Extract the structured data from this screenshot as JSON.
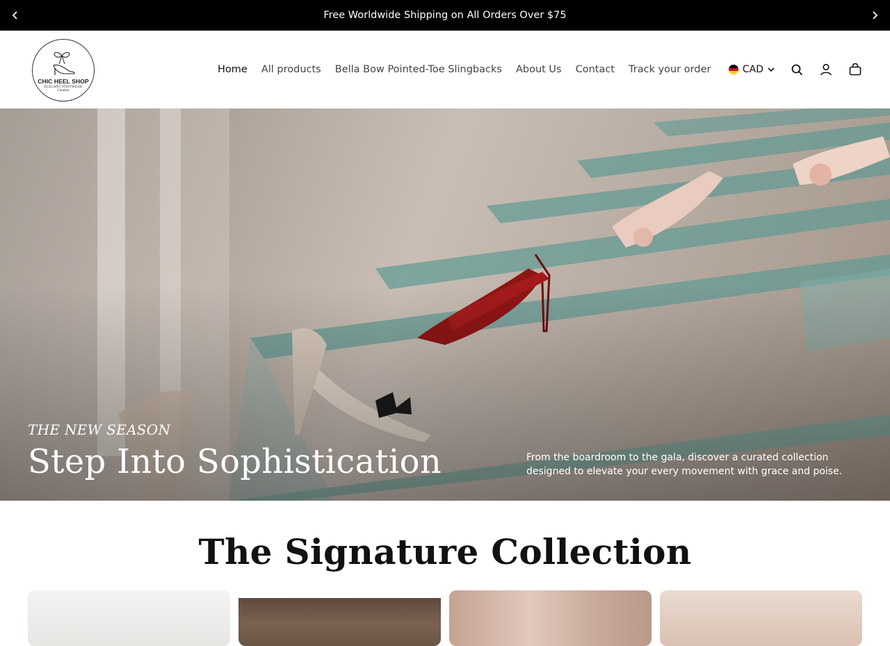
{
  "announcement": {
    "text": "Free Worldwide Shipping on All Orders Over $75",
    "prev_icon": "chevron-left-icon",
    "next_icon": "chevron-right-icon"
  },
  "logo": {
    "name": "CHIC HEEL SHOP",
    "tagline": "ELEGANT FOOTWEAR",
    "tagline2": "Curation"
  },
  "nav": {
    "items": [
      {
        "label": "Home",
        "active": true
      },
      {
        "label": "All products"
      },
      {
        "label": "Bella Bow Pointed-Toe Slingbacks"
      },
      {
        "label": "About Us"
      },
      {
        "label": "Contact"
      },
      {
        "label": "Track your order"
      }
    ]
  },
  "tools": {
    "currency": "CAD",
    "flag_colors": [
      "#c8102e",
      "#ffffff",
      "#000000"
    ],
    "icons": [
      "search-icon",
      "account-icon",
      "cart-icon"
    ]
  },
  "hero": {
    "eyebrow": "THE NEW SEASON",
    "headline": "Step Into Sophistication",
    "description": "From the boardroom to the gala, discover a curated collection designed to elevate your every movement with grace and poise."
  },
  "collection": {
    "title": "The Signature Collection"
  },
  "colors": {
    "announcement_bg": "#000000",
    "text_dark": "#111111"
  }
}
